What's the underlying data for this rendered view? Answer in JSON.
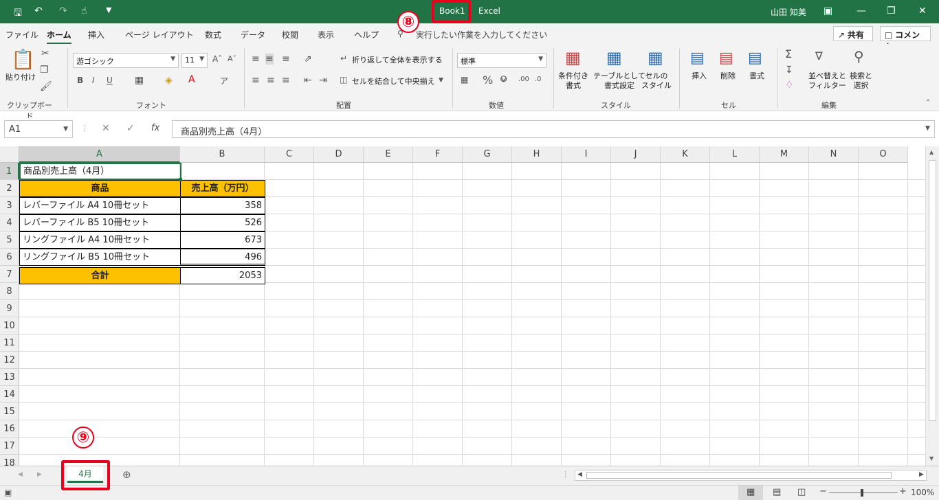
{
  "window": {
    "doc_title": "Book1",
    "app_name": "Excel",
    "user": "山田 知美"
  },
  "tabs": [
    "ファイル",
    "ホーム",
    "挿入",
    "ページ レイアウト",
    "数式",
    "データ",
    "校閲",
    "表示",
    "ヘルプ"
  ],
  "tell_me": "実行したい作業を入力してください",
  "share_label": "共有",
  "comment_label": "コメント",
  "ribbon": {
    "paste_label": "貼り付け",
    "clipboard_group": "クリップボード",
    "font_name": "游ゴシック",
    "font_size": "11",
    "font_group": "フォント",
    "wrap_text": "折り返して全体を表示する",
    "merge_center": "セルを結合して中央揃え",
    "align_group": "配置",
    "number_format": "標準",
    "number_group": "数値",
    "cond_format": "条件付き\n書式",
    "format_table": "テーブルとして\n書式設定",
    "cell_styles": "セルの\nスタイル",
    "styles_group": "スタイル",
    "insert": "挿入",
    "delete": "削除",
    "format": "書式",
    "cells_group": "セル",
    "sort_filter": "並べ替えと\nフィルター",
    "find_select": "検索と\n選択",
    "edit_group": "編集"
  },
  "namebox": "A1",
  "formula": "商品別売上高（4月）",
  "columns": [
    "A",
    "B",
    "C",
    "D",
    "E",
    "F",
    "G",
    "H",
    "I",
    "J",
    "K",
    "L",
    "M",
    "N",
    "O"
  ],
  "rows": [
    "1",
    "2",
    "3",
    "4",
    "5",
    "6",
    "7",
    "8",
    "9",
    "10",
    "11",
    "12",
    "13",
    "14",
    "15",
    "16",
    "17",
    "18"
  ],
  "cells": {
    "a1": "商品別売上高（4月）",
    "a2": "商品",
    "b2": "売上高（万円）",
    "a3": "レバーファイル A4 10冊セット",
    "b3": "358",
    "a4": "レバーファイル B5 10冊セット",
    "b4": "526",
    "a5": "リングファイル A4 10冊セット",
    "b5": "673",
    "a6": "リングファイル B5 10冊セット",
    "b6": "496",
    "a7": "合計",
    "b7": "2053"
  },
  "sheet_tab": "4月",
  "zoom": "100%",
  "annotations": {
    "eight": "⑧",
    "nine": "⑨"
  },
  "colors": {
    "excel_green": "#217346",
    "header_fill": "#ffc000",
    "annotation_red": "#e8001c"
  }
}
